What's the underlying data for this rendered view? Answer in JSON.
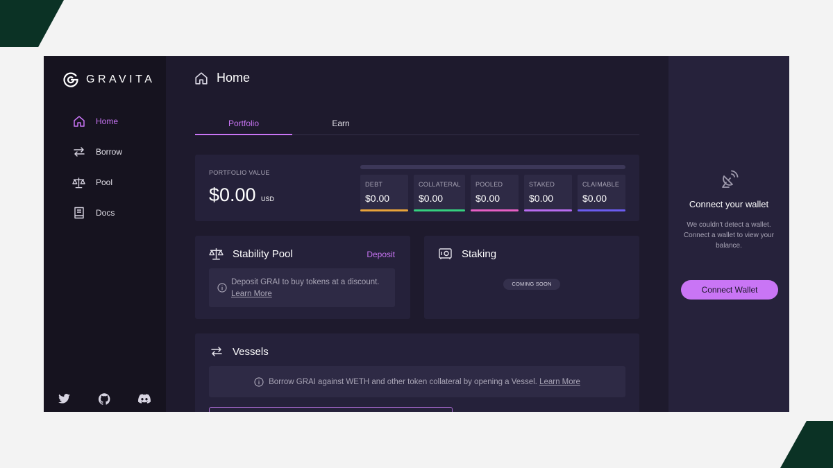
{
  "brand": {
    "name": "GRAVITA",
    "logo_icon": "gravita-logo-icon",
    "accent": "#c975f5"
  },
  "sidebar": {
    "items": [
      {
        "label": "Home",
        "icon": "home-icon",
        "active": true
      },
      {
        "label": "Borrow",
        "icon": "arrows-swap-icon",
        "active": false
      },
      {
        "label": "Pool",
        "icon": "balance-scale-icon",
        "active": false
      },
      {
        "label": "Docs",
        "icon": "book-icon",
        "active": false
      }
    ],
    "social": [
      "twitter-icon",
      "github-icon",
      "discord-icon"
    ]
  },
  "header": {
    "title": "Home",
    "icon": "home-icon"
  },
  "tabs": [
    {
      "label": "Portfolio",
      "active": true
    },
    {
      "label": "Earn",
      "active": false
    }
  ],
  "portfolio": {
    "label": "PORTFOLIO VALUE",
    "value": "$0.00",
    "unit": "USD",
    "stats": [
      {
        "label": "DEBT",
        "value": "$0.00",
        "color": "#e8a33a"
      },
      {
        "label": "COLLATERAL",
        "value": "$0.00",
        "color": "#35d07f"
      },
      {
        "label": "POOLED",
        "value": "$0.00",
        "color": "#e65fc4"
      },
      {
        "label": "STAKED",
        "value": "$0.00",
        "color": "#b76cf0"
      },
      {
        "label": "CLAIMABLE",
        "value": "$0.00",
        "color": "#6b5cf0"
      }
    ]
  },
  "stability_pool": {
    "title": "Stability Pool",
    "action": "Deposit",
    "info": "Deposit GRAI to buy tokens at a discount.",
    "link": "Learn More"
  },
  "staking": {
    "title": "Staking",
    "badge": "COMING SOON"
  },
  "vessels": {
    "title": "Vessels",
    "info": "Borrow GRAI against WETH and other token collateral by opening a Vessel.",
    "link": "Learn More"
  },
  "wallet": {
    "title": "Connect your wallet",
    "description": "We couldn't detect a wallet. Connect a wallet to view your balance.",
    "button": "Connect Wallet",
    "icon": "satellite-dish-icon"
  }
}
